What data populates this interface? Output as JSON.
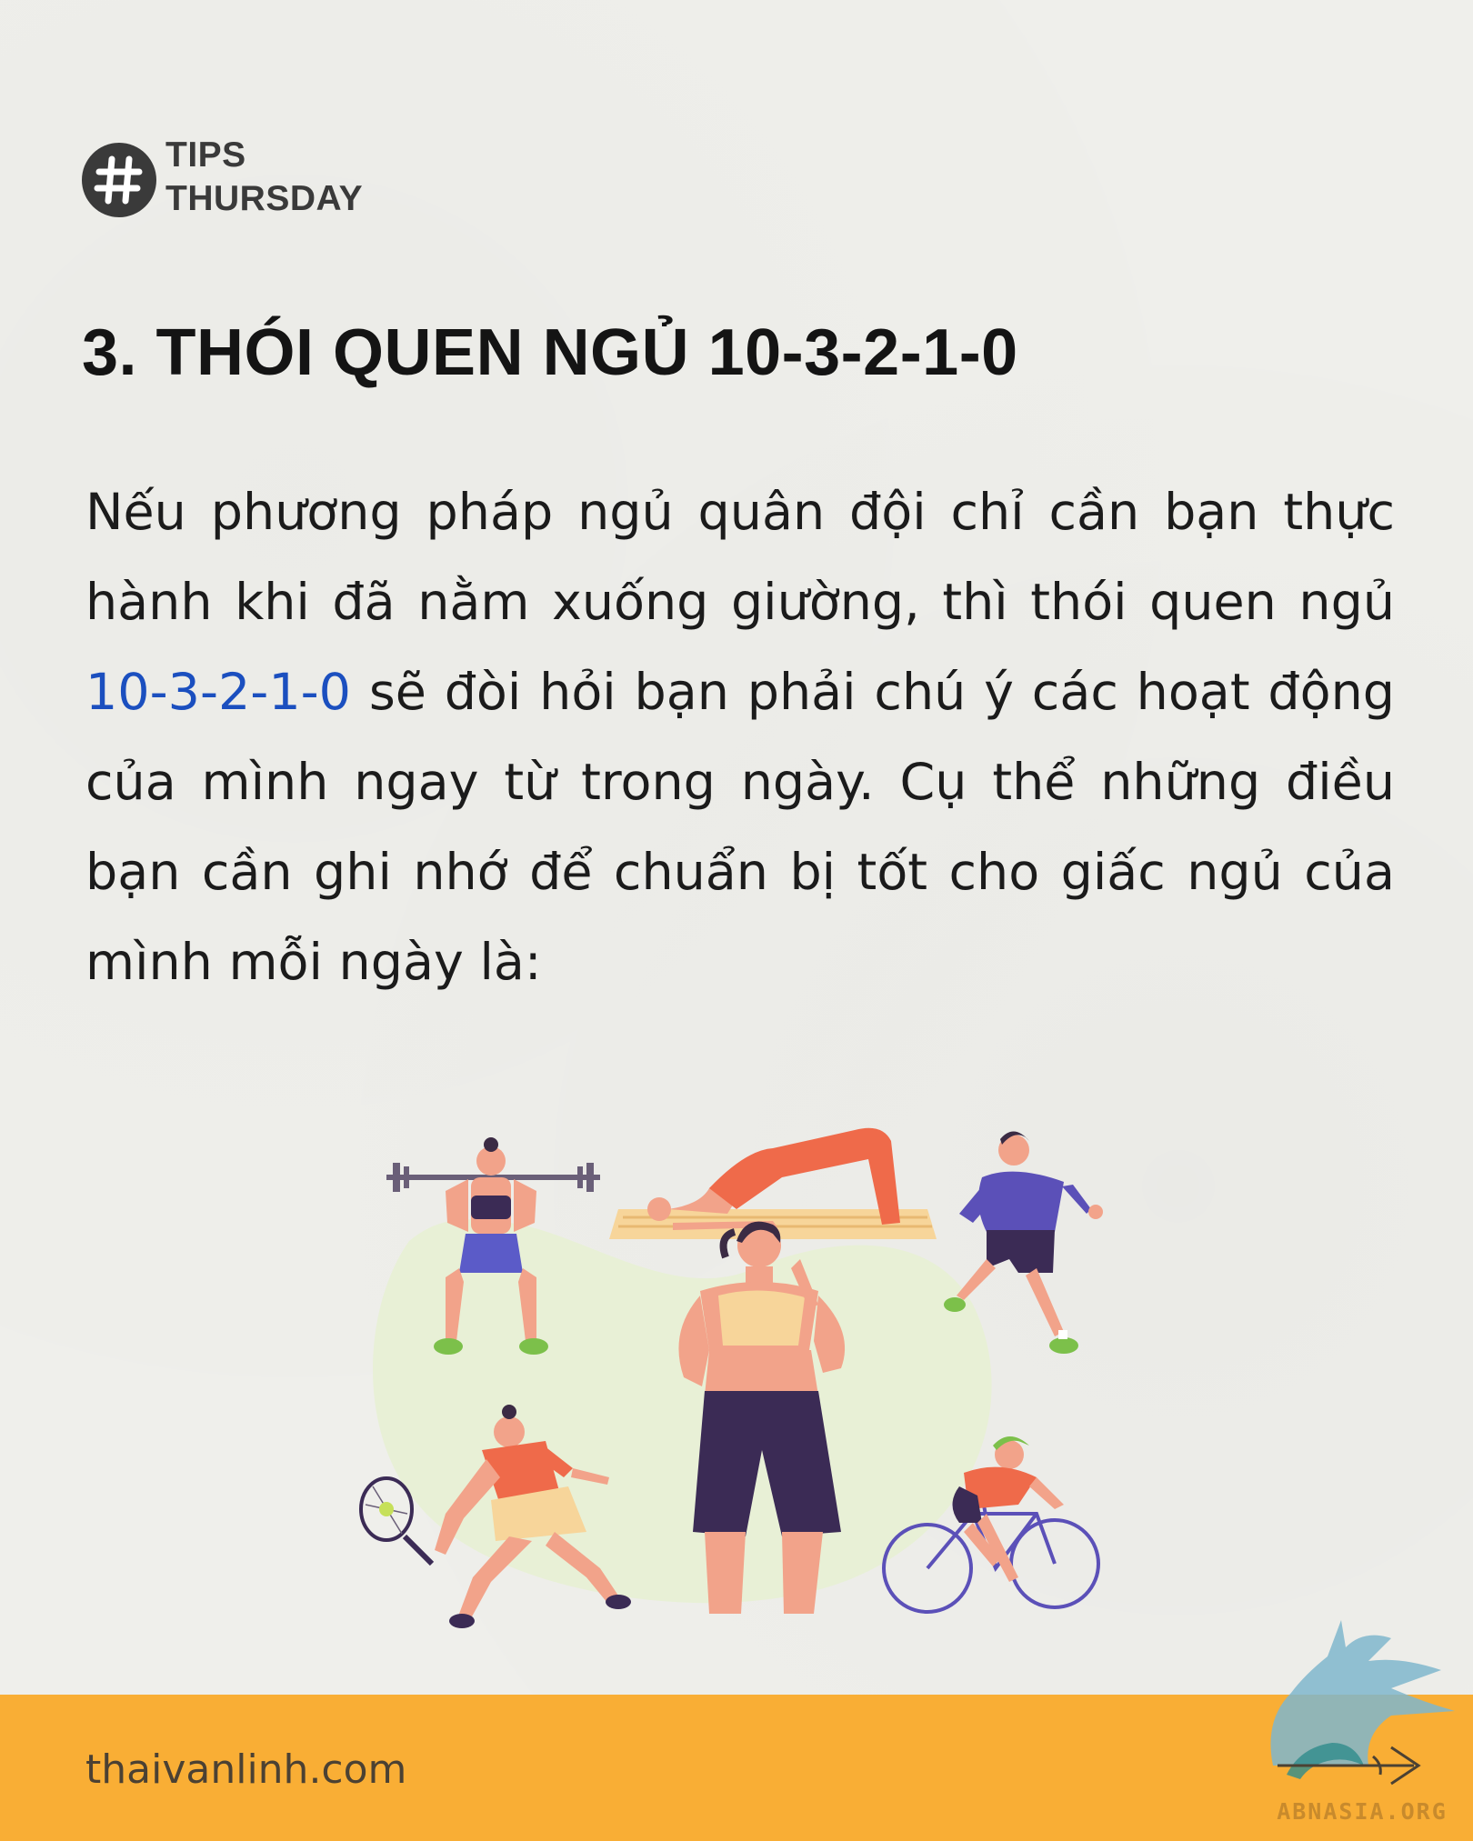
{
  "header": {
    "tag_icon": "hashtag-icon",
    "tag_line1": "TIPS",
    "tag_line2": "THURSDAY"
  },
  "title": "3. THÓI QUEN NGỦ 10-3-2-1-0",
  "body": {
    "text_before": "Nếu phương pháp ngủ quân đội chỉ cần bạn thực hành khi đã nằm xuống giường, thì thói quen ngủ ",
    "highlight": "10-3-2-1-0",
    "text_after": " sẽ đòi hỏi bạn phải chú ý các hoạt động của mình ngay từ trong ngày. Cụ thể những điều bạn cần ghi nhớ để chuẩn bị tốt cho giấc ngủ của mình mỗi ngày là:"
  },
  "footer": {
    "website": "thaivanlinh.com",
    "logo_text": "ABNASIA.ORG"
  },
  "colors": {
    "footer_bg": "#f9ae35",
    "highlight": "#1b4fbf",
    "badge": "#3a3a3a"
  }
}
